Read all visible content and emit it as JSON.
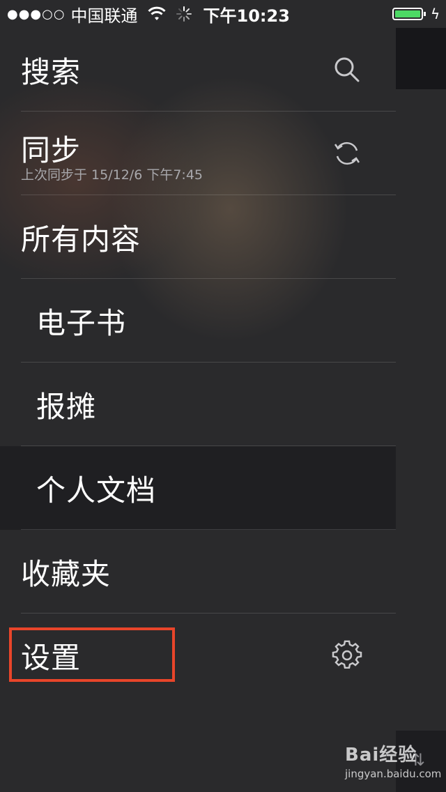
{
  "status_bar": {
    "signal": "●●●○○",
    "carrier": "中国联通",
    "time": "下午10:23",
    "battery_level": 1.0,
    "battery_color": "#4cd964"
  },
  "menu": {
    "items": [
      {
        "label": "搜索",
        "icon": "search-icon"
      },
      {
        "label": "同步",
        "sublabel": "上次同步于 15/12/6 下午7:45",
        "icon": "sync-icon"
      },
      {
        "label": "所有内容"
      },
      {
        "label": "电子书"
      },
      {
        "label": "报摊"
      },
      {
        "label": "个人文档",
        "selected": true
      },
      {
        "label": "收藏夹"
      },
      {
        "label": "设置",
        "icon": "gear-icon",
        "highlighted": true
      }
    ]
  },
  "colors": {
    "background": "#2a2a2c",
    "selected_row": "#1f1f22",
    "highlight_box": "#e8452a"
  },
  "watermark": {
    "brand": "Bai经验",
    "url": "jingyan.baidu.com"
  }
}
